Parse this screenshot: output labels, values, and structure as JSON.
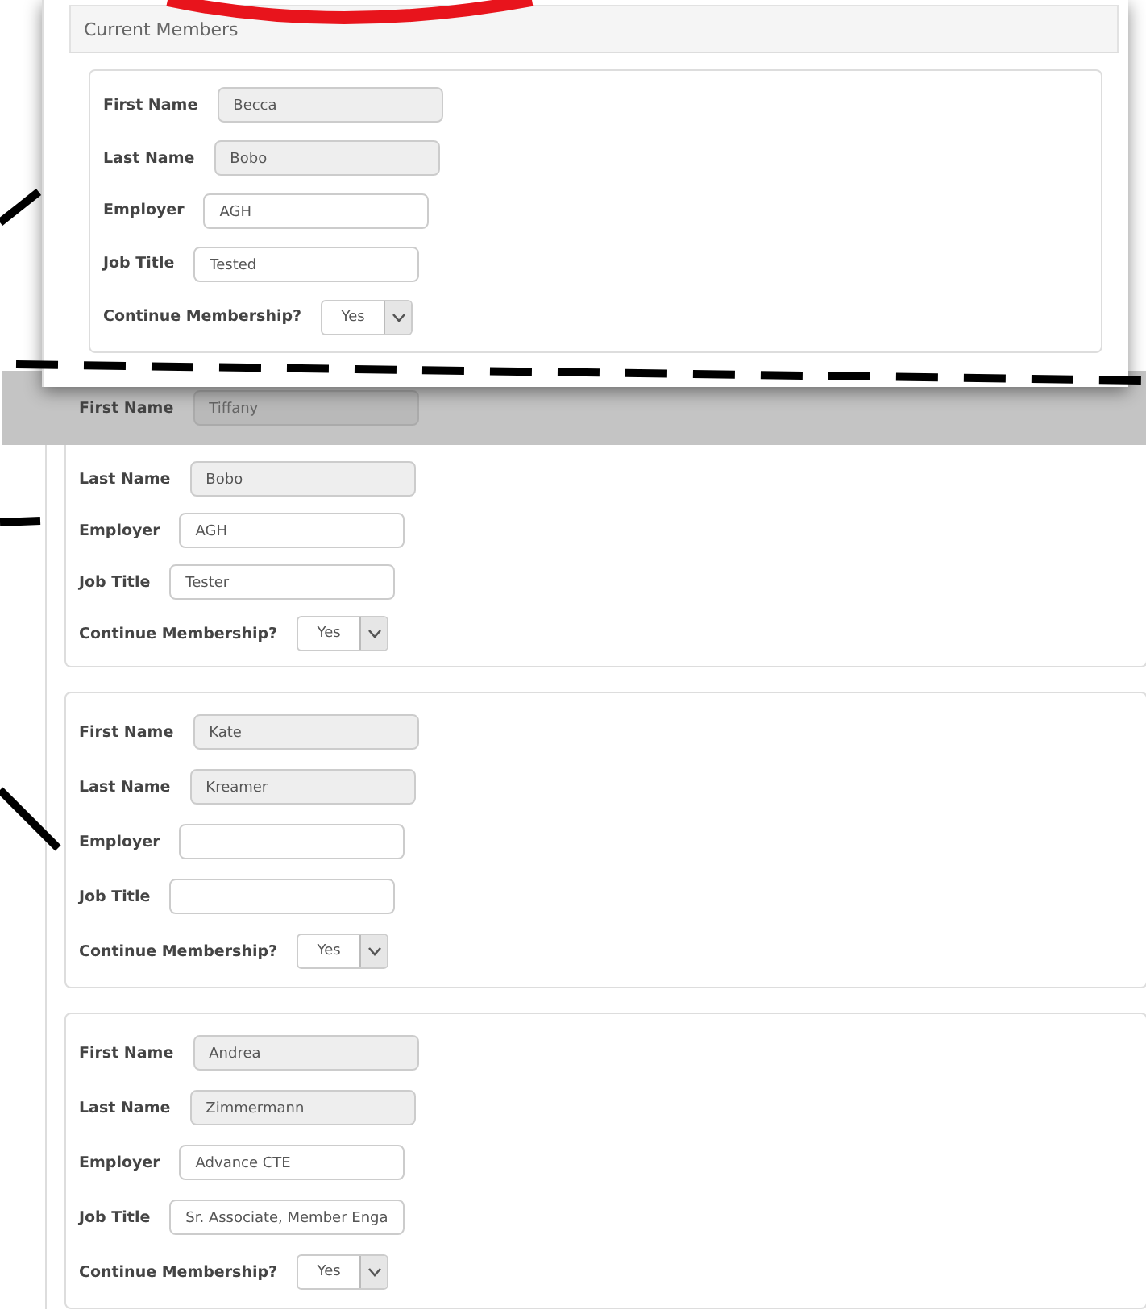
{
  "current_members": {
    "title": "Current Members",
    "members": [
      {
        "fields": [
          {
            "kind": "text",
            "label": "First Name",
            "value": "Becca",
            "disabled": true
          },
          {
            "kind": "text",
            "label": "Last Name",
            "value": "Bobo",
            "disabled": true
          },
          {
            "kind": "text",
            "label": "Employer",
            "value": "AGH",
            "disabled": false
          },
          {
            "kind": "text",
            "label": "Job Title",
            "value": "Tested",
            "disabled": false
          },
          {
            "kind": "select",
            "label": "Continue Membership?",
            "value": "Yes",
            "disabled": false
          }
        ]
      }
    ]
  },
  "more_members": [
    {
      "fields": [
        {
          "kind": "text",
          "label": "First Name",
          "value": "Tiffany",
          "disabled": true
        },
        {
          "kind": "text",
          "label": "Last Name",
          "value": "Bobo",
          "disabled": true
        },
        {
          "kind": "text",
          "label": "Employer",
          "value": "AGH",
          "disabled": false
        },
        {
          "kind": "text",
          "label": "Job Title",
          "value": "Tester",
          "disabled": false
        },
        {
          "kind": "select",
          "label": "Continue Membership?",
          "value": "Yes",
          "disabled": false
        }
      ]
    },
    {
      "fields": [
        {
          "kind": "text",
          "label": "First Name",
          "value": "Kate",
          "disabled": true
        },
        {
          "kind": "text",
          "label": "Last Name",
          "value": "Kreamer",
          "disabled": true
        },
        {
          "kind": "text",
          "label": "Employer",
          "disabled": false
        },
        {
          "kind": "text",
          "label": "Job Title",
          "disabled": false
        },
        {
          "kind": "select",
          "label": "Continue Membership?",
          "value": "Yes",
          "disabled": false
        }
      ]
    },
    {
      "fields": [
        {
          "kind": "text",
          "label": "First Name",
          "value": "Andrea",
          "disabled": true
        },
        {
          "kind": "text",
          "label": "Last Name",
          "value": "Zimmermann",
          "disabled": true
        },
        {
          "kind": "text",
          "label": "Employer",
          "value": "Advance CTE",
          "disabled": false
        },
        {
          "kind": "text",
          "label": "Job Title",
          "value": "Sr. Associate, Member Enga",
          "disabled": false
        },
        {
          "kind": "select",
          "label": "Continue Membership?",
          "value": "Yes",
          "disabled": false
        }
      ]
    }
  ]
}
